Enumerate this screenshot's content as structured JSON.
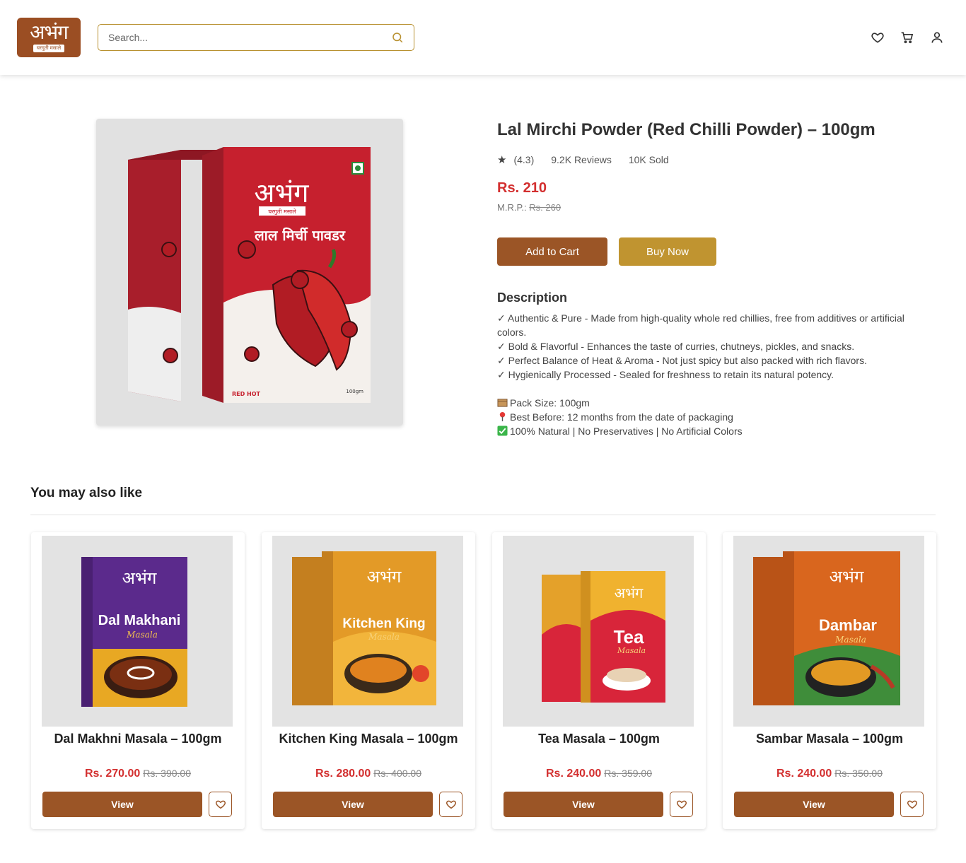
{
  "header": {
    "logo_text": "अभंग",
    "logo_tagline": "घरगुती मसाले",
    "search_placeholder": "Search..."
  },
  "product": {
    "title": "Lal Mirchi Powder (Red Chilli Powder) – 100gm",
    "rating": "(4.3)",
    "reviews": "9.2K Reviews",
    "sold": "10K Sold",
    "price": "Rs. 210",
    "mrp_label": "M.R.P.:",
    "mrp_value": "Rs. 260",
    "add_to_cart": "Add to Cart",
    "buy_now": "Buy Now",
    "image_pack_text": "लाल मिर्ची पावडर",
    "image_brand": "अभंग",
    "image_tagline": "घरगुती मसाले",
    "image_badge": "RED HOT",
    "image_weight": "100gm",
    "description_heading": "Description",
    "description_lines": [
      "✓ Authentic & Pure - Made from high-quality whole red chillies, free from additives or artificial colors.",
      "✓ Bold & Flavorful - Enhances the taste of curries, chutneys, pickles, and snacks.",
      "✓ Perfect Balance of Heat & Aroma - Not just spicy but also packed with rich flavors.",
      "✓ Hygienically Processed - Sealed for freshness to retain its natural potency."
    ],
    "info_lines": [
      "Pack Size: 100gm",
      "Best Before: 12 months from the date of packaging",
      "100% Natural | No Preservatives | No Artificial Colors"
    ]
  },
  "recommendations": {
    "heading": "You may also like",
    "view_label": "View",
    "items": [
      {
        "name": "Dal Makhni Masala – 100gm",
        "price": "Rs. 270.00",
        "old_price": "Rs. 390.00",
        "pack_title": "Dal Makhani",
        "pack_sub": "Masala",
        "pack_color": "#5b2a8c",
        "accent": "#e8a823"
      },
      {
        "name": "Kitchen King Masala – 100gm",
        "price": "Rs. 280.00",
        "old_price": "Rs. 400.00",
        "pack_title": "Kitchen King",
        "pack_sub": "Masala",
        "pack_color": "#e39a27",
        "accent": "#f2b53b"
      },
      {
        "name": "Tea Masala – 100gm",
        "price": "Rs. 240.00",
        "old_price": "Rs. 359.00",
        "pack_title": "Tea",
        "pack_sub": "Masala",
        "pack_color": "#f0b22f",
        "accent": "#d8253a"
      },
      {
        "name": "Sambar Masala – 100gm",
        "price": "Rs. 240.00",
        "old_price": "Rs. 350.00",
        "pack_title": "Dambar",
        "pack_sub": "Masala",
        "pack_color": "#d9661e",
        "accent": "#b83a26"
      }
    ]
  },
  "colors": {
    "brand": "#9b4e23",
    "button_brown": "#9b5526",
    "button_gold": "#c09430",
    "price_red": "#d32f2f"
  },
  "icons": {
    "search": "search-icon",
    "wishlist": "heart-icon",
    "cart": "cart-icon",
    "account": "user-icon"
  }
}
